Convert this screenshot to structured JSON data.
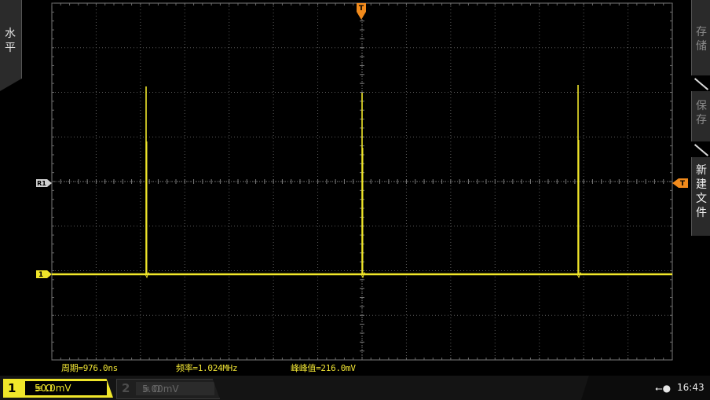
{
  "left_tab": {
    "label": "水平"
  },
  "right_menu": {
    "items": [
      {
        "label": "存储",
        "state": "dim"
      },
      {
        "label": "保存",
        "state": "dim"
      },
      {
        "label": "新建文件",
        "state": "lit"
      }
    ]
  },
  "markers": {
    "trigger_time": "T",
    "trigger_level": "T",
    "ref": "R1",
    "channel1": "1"
  },
  "measurements": {
    "period": "周期=976.0ns",
    "frequency": "频率=1.024MHz",
    "peak_to_peak": "峰峰值=216.0mV"
  },
  "channels": {
    "ch1": {
      "number": "1",
      "coupling": "≡ Ω",
      "scale": "50.0mV",
      "active": true
    },
    "ch2": {
      "number": "2",
      "coupling": "≡ Ω",
      "scale": "5.00mV",
      "active": false
    }
  },
  "status": {
    "usb_icon": "usb-icon",
    "time": "16:43"
  },
  "colors": {
    "ch1": "#f0e62a",
    "trigger": "#f08a1c",
    "grid": "#6a6a6a"
  }
}
